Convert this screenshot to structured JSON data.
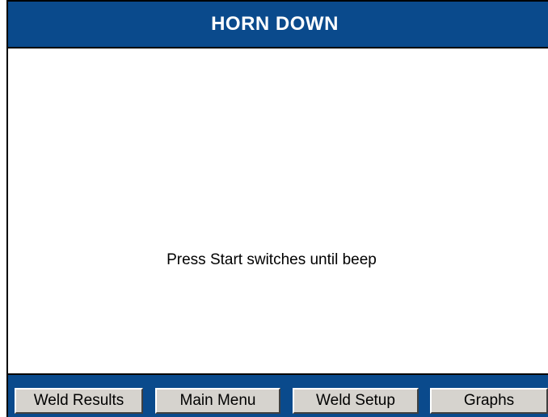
{
  "title": "HORN DOWN",
  "message": "Press Start switches until beep",
  "buttons": {
    "weld_results": "Weld Results",
    "main_menu": "Main Menu",
    "weld_setup": "Weld Setup",
    "graphs": "Graphs"
  },
  "colors": {
    "title_bar": "#0a4a8c",
    "button_face": "#d6d3ce"
  }
}
